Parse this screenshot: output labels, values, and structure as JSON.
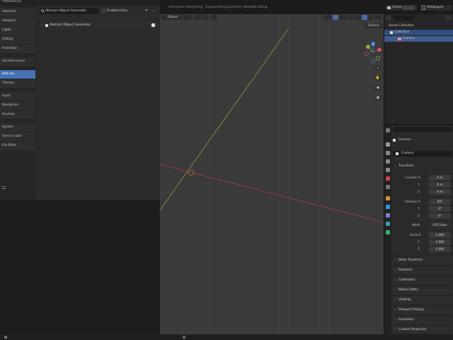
{
  "topbar": {
    "workspace_tabs": [
      "Animation",
      "Rendering",
      "Compositing",
      "Geometry Nodes",
      "Scripting"
    ],
    "scene_label": "Scene",
    "viewlayer_label": "ViewLayer"
  },
  "preferences": {
    "title": "Preferences",
    "sidebar_groups": [
      [
        "Interface",
        "Viewport",
        "Lights",
        "Editing",
        "Animation"
      ],
      [
        "Get Extensions"
      ],
      [
        "Add-ons",
        "Themes"
      ],
      [
        "Input",
        "Navigation",
        "Keymap"
      ],
      [
        "System",
        "Save & Load",
        "File Paths"
      ]
    ],
    "active_item": "Add-ons",
    "search_value": "Abstract Object Generator",
    "enabled_only_label": "Enabled Only",
    "addon_name": "Abstract Object Generator"
  },
  "viewport": {
    "orientation_label": "Global",
    "options_label": "Options",
    "axis_x_color": "#b3364a",
    "axis_y_color": "#7ea82a",
    "gizmo_labels": [
      "X",
      "Y",
      "Z"
    ]
  },
  "outliner": {
    "root_label": "Scene Collection",
    "collection_label": "Collection",
    "camera_label": "Camera"
  },
  "properties": {
    "object_name": "Camera",
    "data_name": "Camera",
    "transform_label": "Transform",
    "location_label": "Location X",
    "location_values": [
      "0 m",
      "0 m",
      "0 m"
    ],
    "rotation_label": "Rotation X",
    "rotation_values": [
      "90°",
      "0°",
      "0°"
    ],
    "mode_label": "Mode",
    "mode_value": "XYZ Euler",
    "scale_label": "Scale X",
    "scale_values": [
      "1.000",
      "1.000",
      "1.000"
    ],
    "axis_y": "Y",
    "axis_z": "Z",
    "collapsed_panels": [
      "Delta Transform",
      "Relations",
      "Collections",
      "Motion Paths",
      "Visibility",
      "Viewport Display",
      "Animation",
      "Custom Properties"
    ]
  }
}
